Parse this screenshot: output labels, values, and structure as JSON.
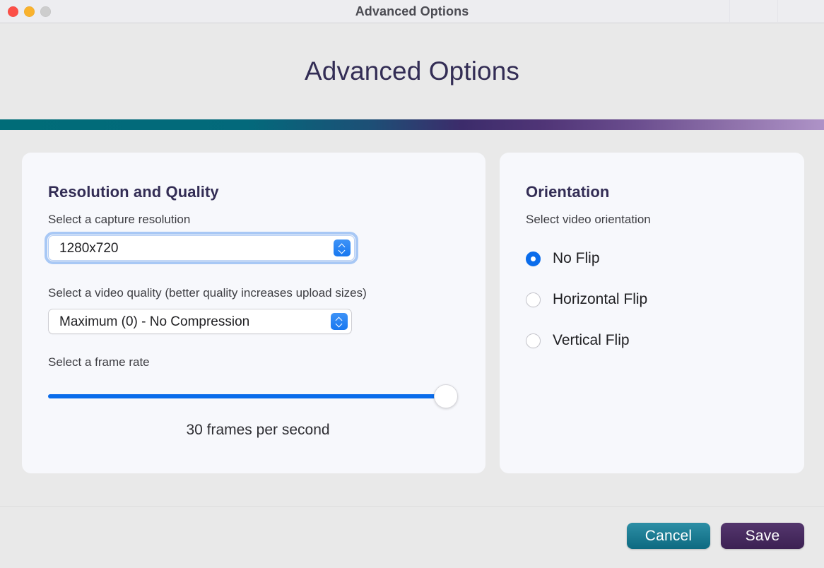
{
  "window": {
    "titlebar_title": "Advanced Options",
    "traffic_lights": [
      {
        "name": "close",
        "color": "#fc4f47"
      },
      {
        "name": "minimize",
        "color": "#f9b22d"
      },
      {
        "name": "zoom",
        "color": "#cdcdcd"
      }
    ]
  },
  "header": {
    "page_title": "Advanced Options",
    "accent_colors": [
      "#006c78",
      "#3c2c6b",
      "#ae93c7"
    ]
  },
  "resolution_panel": {
    "title": "Resolution and Quality",
    "resolution": {
      "label": "Select a capture resolution",
      "value": "1280x720",
      "focused": true
    },
    "quality": {
      "label": "Select a video quality (better quality increases upload sizes)",
      "value": "Maximum (0) - No Compression",
      "focused": false
    },
    "frame_rate": {
      "label": "Select a frame rate",
      "value_text": "30 frames per second",
      "value": 30,
      "percent": 100,
      "fill_color": "#0a6ceb"
    }
  },
  "orientation_panel": {
    "title": "Orientation",
    "label": "Select video orientation",
    "options": [
      {
        "label": "No Flip",
        "selected": true
      },
      {
        "label": "Horizontal Flip",
        "selected": false
      },
      {
        "label": "Vertical Flip",
        "selected": false
      }
    ],
    "selected_color": "#0a6ceb"
  },
  "footer": {
    "cancel_label": "Cancel",
    "save_label": "Save",
    "cancel_color": "#0d6a81",
    "save_color": "#3c2153"
  }
}
